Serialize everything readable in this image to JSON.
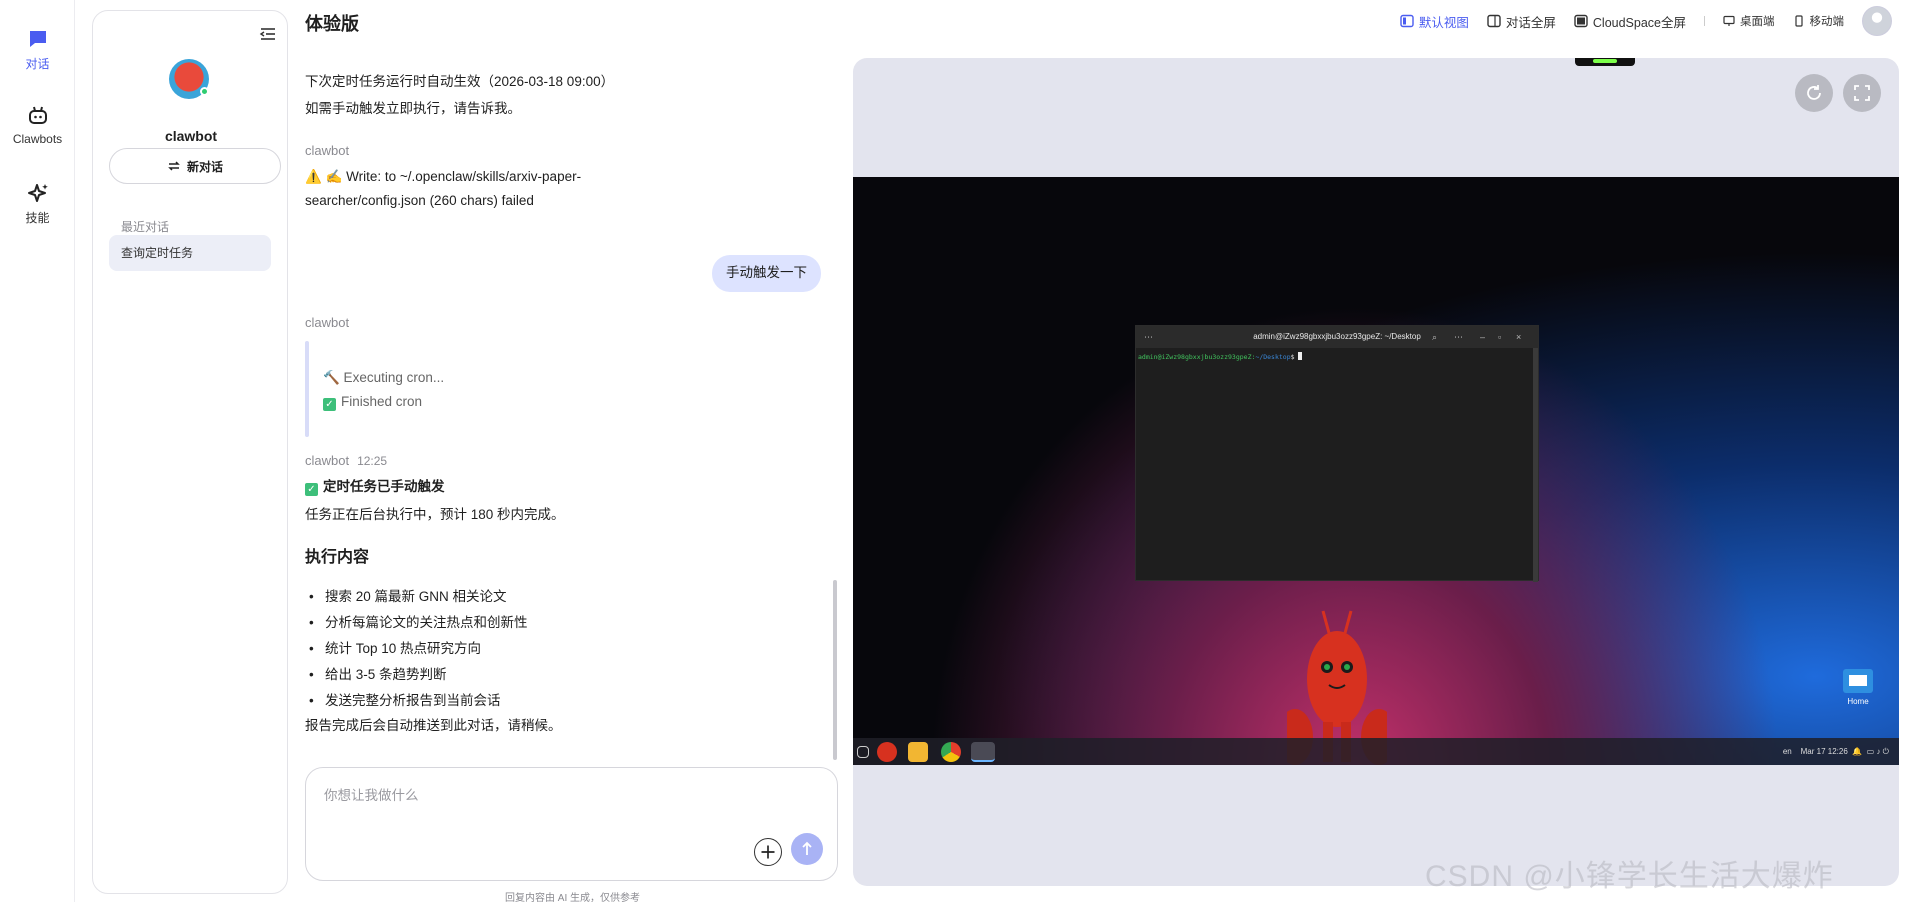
{
  "nav": {
    "items": [
      {
        "label": "对话",
        "icon": "chat-icon",
        "active": true
      },
      {
        "label": "Clawbots",
        "icon": "robot-icon",
        "active": false
      },
      {
        "label": "技能",
        "icon": "sparkle-icon",
        "active": false
      }
    ]
  },
  "sidebar": {
    "bot_name": "clawbot",
    "new_chat_label": "新对话",
    "recent_label": "最近对话",
    "recent_items": [
      "查询定时任务"
    ]
  },
  "header": {
    "title": "体验版",
    "views": [
      {
        "label": "默认视图",
        "active": true
      },
      {
        "label": "对话全屏",
        "active": false
      },
      {
        "label": "CloudSpace全屏",
        "active": false
      }
    ],
    "devices": [
      {
        "label": "桌面端"
      },
      {
        "label": "移动端"
      }
    ]
  },
  "chat": {
    "msg1_line1": "下次定时任务运行时自动生效（2026-03-18 09:00）",
    "msg1_line2": "如需手动触发立即执行，请告诉我。",
    "sender": "clawbot",
    "msg2_line1": "⚠️  ✍️  Write: to ~/.openclaw/skills/arxiv-paper-",
    "msg2_line2": "searcher/config.json (260 chars) failed",
    "user_message": "手动触发一下",
    "exec_line1": "🔨 Executing cron...",
    "exec_line2": "Finished cron",
    "time": "12:25",
    "done_title": "定时任务已手动触发",
    "done_desc": "任务正在后台执行中，预计 180 秒内完成。",
    "section_title": "执行内容",
    "bullets": [
      "搜索 20 篇最新 GNN 相关论文",
      "分析每篇论文的关注热点和创新性",
      "统计 Top 10 热点研究方向",
      "给出 3-5 条趋势判断",
      "发送完整分析报告到当前会话"
    ],
    "closing": "报告完成后会自动推送到此对话，请稍候。"
  },
  "input": {
    "placeholder": "你想让我做什么",
    "disclaimer": "回复内容由 AI 生成，仅供参考"
  },
  "desktop": {
    "terminal_title": "admin@iZwz98gbxxjbu3ozz93gpeZ: ~/Desktop",
    "prompt_user": "admin@iZwz98gbxxjbu3ozz93gpeZ:",
    "prompt_path": "~/Desktop",
    "prompt_symbol": "$",
    "home_label": "Home",
    "tray_lang": "en",
    "tray_datetime": "Mar 17  12:26"
  },
  "watermark": "CSDN @小锋学长生活大爆炸",
  "colors": {
    "accent": "#4a5cf0",
    "user_bubble": "#dde3ff",
    "send_button": "#a9b3f5",
    "panel_bg": "#e3e4ee"
  }
}
